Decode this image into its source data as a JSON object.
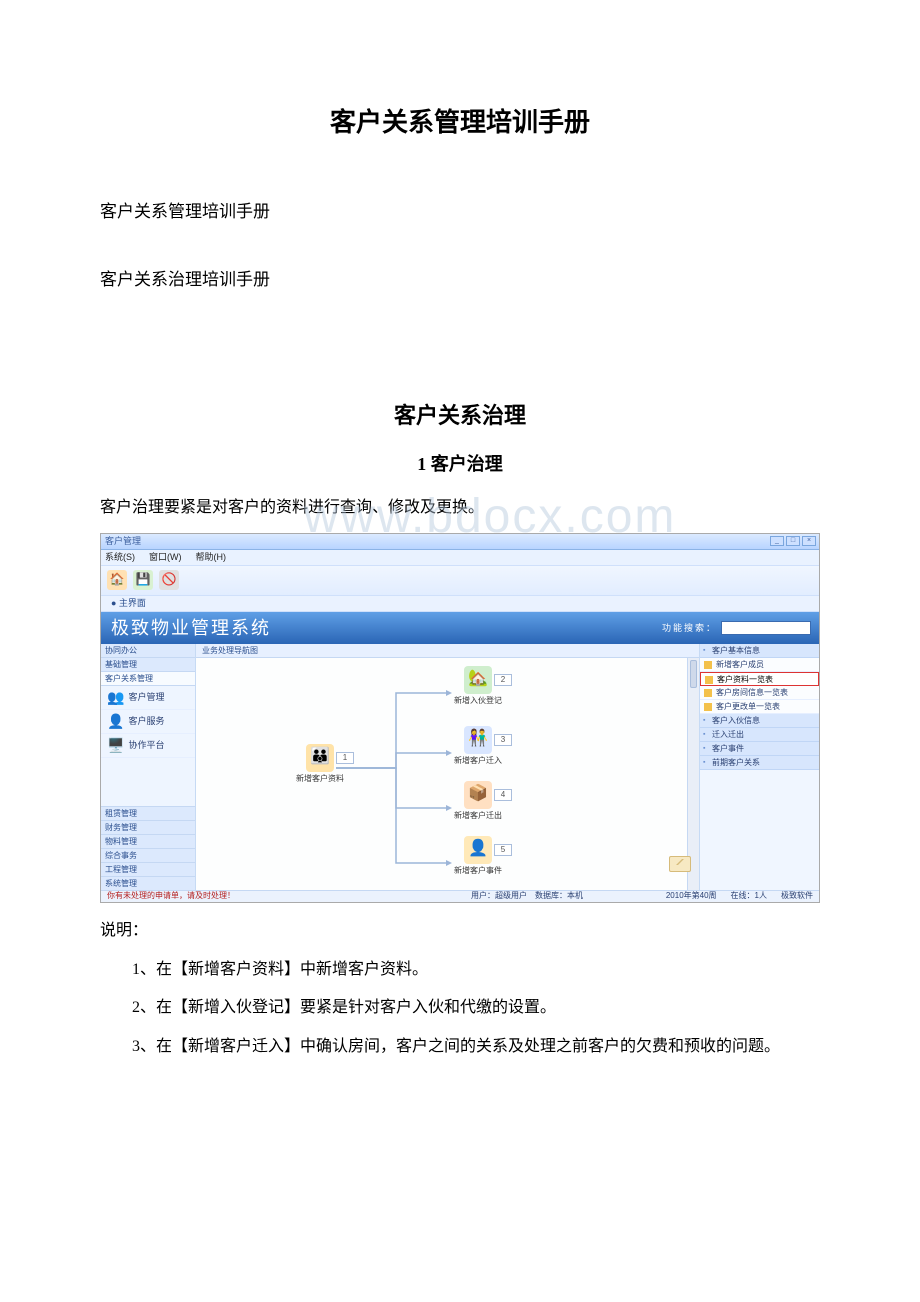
{
  "doc": {
    "title": "客户关系管理培训手册",
    "para1": "客户关系管理培训手册",
    "para2": "客户关系治理培训手册",
    "section_title": "客户关系治理",
    "subsection_title": "1 客户治理",
    "intro": "客户治理要紧是对客户的资料进行查询、修改及更换。",
    "explain_label": "说明：",
    "explain_1": "1、在【新增客户资料】中新增客户资料。",
    "explain_2": "2、在【新增入伙登记】要紧是针对客户入伙和代缴的设置。",
    "explain_3": "3、在【新增客户迁入】中确认房间，客户之间的关系及处理之前客户的欠费和预收的问题。"
  },
  "screenshot": {
    "titlebar": "客户管理",
    "menubar": {
      "sys": "系统(S)",
      "win": "窗口(W)",
      "help": "帮助(H)"
    },
    "tabbar": {
      "main": "● 主界面"
    },
    "banner": {
      "title": "极致物业管理系统",
      "search_label": "功能搜索："
    },
    "left": {
      "hdr1": "协同办公",
      "hdr2": "基础管理",
      "hdrActive": "客户关系管理",
      "items": {
        "a": "客户管理",
        "b": "客户服务",
        "c": "协作平台"
      },
      "bottom": {
        "b1": "租赁管理",
        "b2": "财务管理",
        "b3": "物料管理",
        "b4": "综合事务",
        "b5": "工程管理",
        "b6": "系统管理"
      }
    },
    "center": {
      "hdr": "业务处理导航图",
      "nodes": {
        "root": "新增客户资料",
        "n2": "新增入伙登记",
        "n3": "新增客户迁入",
        "n4": "新增客户迁出",
        "n5": "新增客户事件"
      },
      "tags": {
        "t1": "1",
        "t2": "2",
        "t3": "3",
        "t4": "4",
        "t5": "5"
      }
    },
    "right": {
      "g1": {
        "hdr": "客户基本信息",
        "i1": "新增客户成员",
        "i2": "客户资料一览表",
        "i3": "客户房间信息一览表",
        "i4": "客户更改单一览表"
      },
      "g2": "客户入伙信息",
      "g3": "迁入迁出",
      "g4": "客户事件",
      "g5": "前期客户关系"
    },
    "status": {
      "left": "你有未处理的申请单，请及时处理！",
      "mid": "用户：超级用户　数据库：本机",
      "r1": "2010年第40周",
      "r2": "在线：1人",
      "r3": "极致软件"
    },
    "watermark": "www.bdocx.com"
  }
}
